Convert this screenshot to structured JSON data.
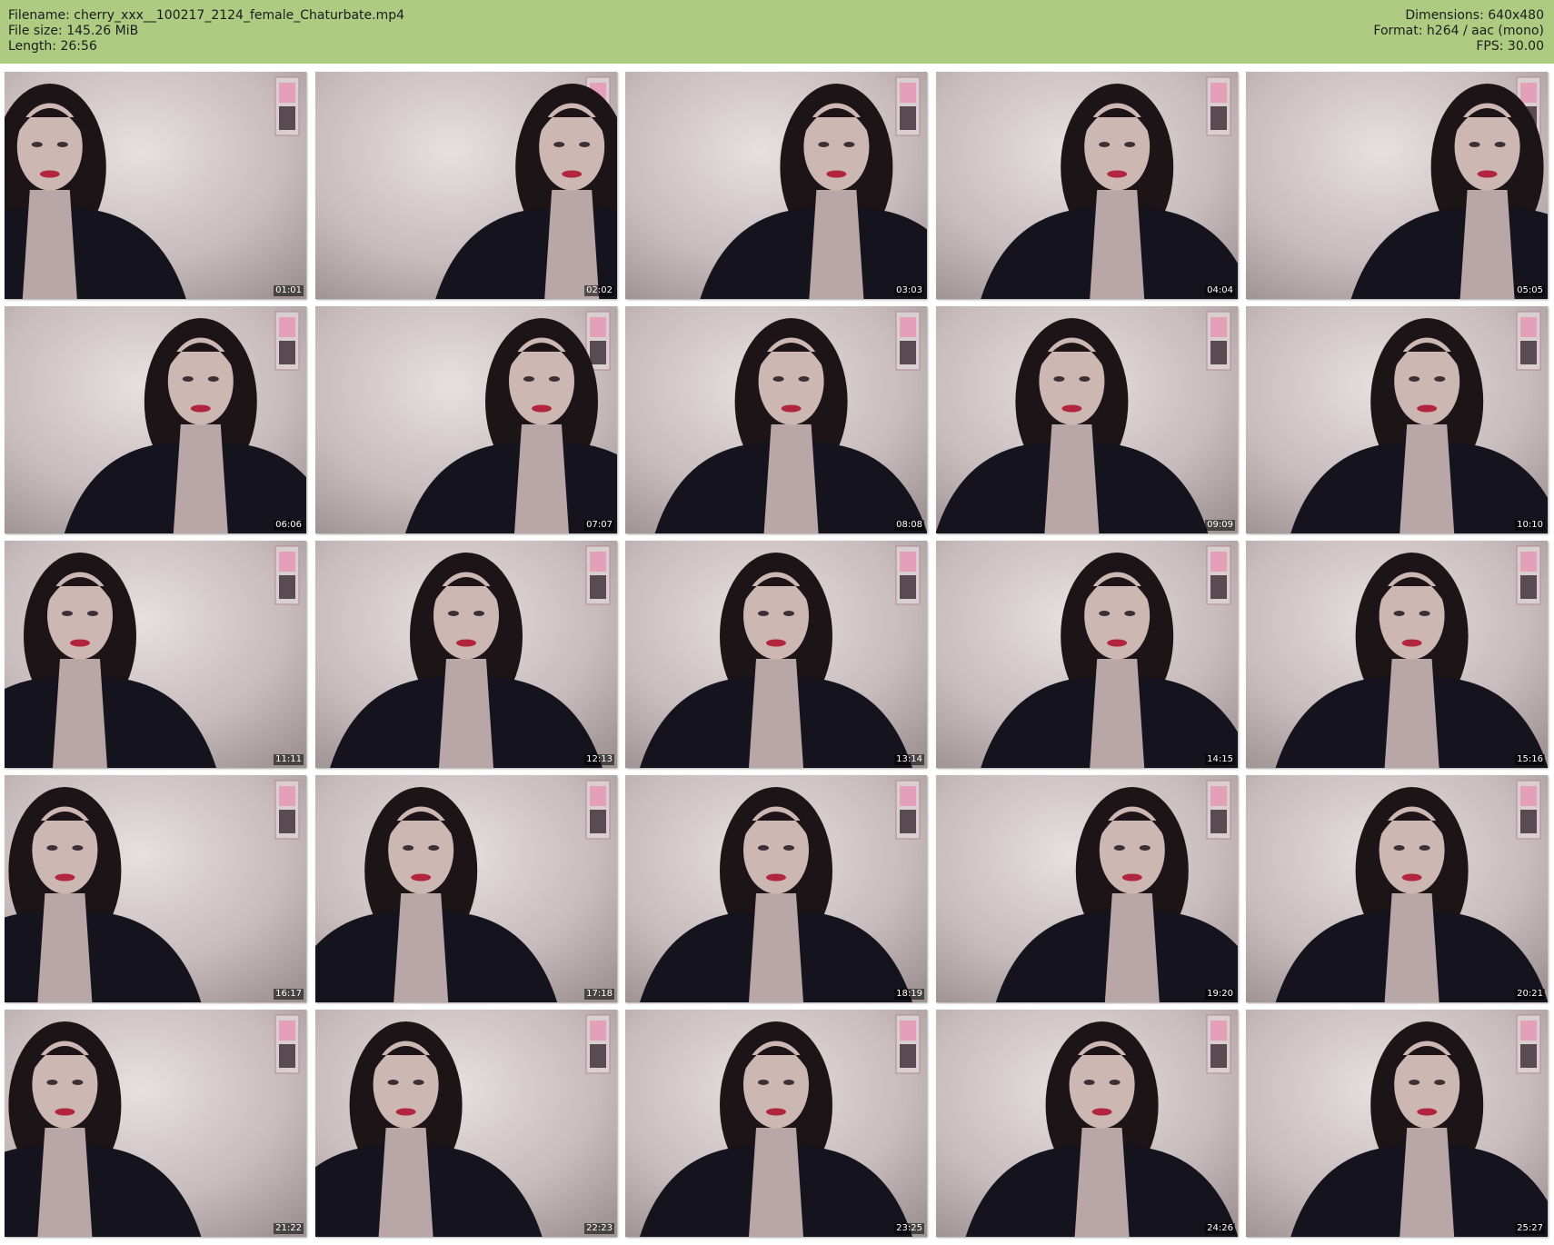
{
  "header": {
    "filename": "Filename: cherry_xxx__100217_2124_female_Chaturbate.mp4",
    "filesize": "File size: 145.26 MiB",
    "length": "Length: 26:56",
    "dimensions": "Dimensions: 640x480",
    "format": "Format: h264 / aac (mono)",
    "fps": "FPS: 30.00",
    "background_color": "#aecb82"
  },
  "thumbnails": [
    {
      "time": "01:01"
    },
    {
      "time": "02:02"
    },
    {
      "time": "03:03"
    },
    {
      "time": "04:04"
    },
    {
      "time": "05:05"
    },
    {
      "time": "06:06"
    },
    {
      "time": "07:07"
    },
    {
      "time": "08:08"
    },
    {
      "time": "09:09"
    },
    {
      "time": "10:10"
    },
    {
      "time": "11:11"
    },
    {
      "time": "12:13"
    },
    {
      "time": "13:14"
    },
    {
      "time": "14:15"
    },
    {
      "time": "15:16"
    },
    {
      "time": "16:17"
    },
    {
      "time": "17:18"
    },
    {
      "time": "18:19"
    },
    {
      "time": "19:20"
    },
    {
      "time": "20:21"
    },
    {
      "time": "21:22"
    },
    {
      "time": "22:23"
    },
    {
      "time": "23:25"
    },
    {
      "time": "24:26"
    },
    {
      "time": "25:27"
    }
  ]
}
